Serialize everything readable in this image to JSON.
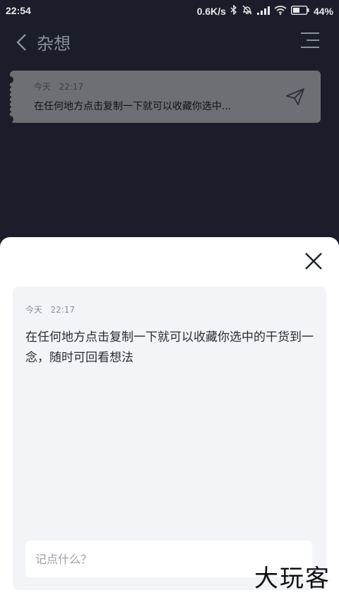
{
  "status_bar": {
    "time": "22:54",
    "net_speed": "0.6K/s",
    "battery": "44%"
  },
  "header": {
    "title": "杂想"
  },
  "list": {
    "items": [
      {
        "date": "今天",
        "time": "22:17",
        "preview": "在任何地方点击复制一下就可以收藏你选中..."
      }
    ]
  },
  "sheet": {
    "date": "今天",
    "time": "22:17",
    "text": "在任何地方点击复制一下就可以收藏你选中的干货到一念，随时可回看想法",
    "input_placeholder": "记点什么？",
    "watermark": "大玩客"
  },
  "colors": {
    "background": "#1b1e2a",
    "list_card": "#6d6f74",
    "sheet": "#ffffff",
    "sheet_card": "#f3f4f8"
  }
}
